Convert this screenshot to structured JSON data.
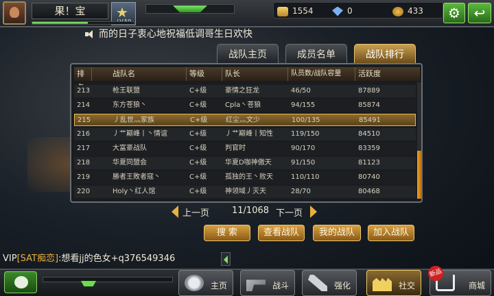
{
  "header": {
    "player_name": "果！宝",
    "rank_level": "LV.59",
    "xp_fraction": 0.55,
    "resources": {
      "gold": "1554",
      "diamond": "0",
      "coin": "433"
    },
    "icons": [
      "gear-icon",
      "back-arrow-icon",
      "gold-icon",
      "diamond-icon",
      "coin-icon"
    ]
  },
  "announcement": {
    "text": "而的日子衷心地祝福低调哥生日欢快"
  },
  "tabs": [
    {
      "label": "战队主页",
      "active": false
    },
    {
      "label": "成员名单",
      "active": false
    },
    {
      "label": "战队排行",
      "active": true
    }
  ],
  "table": {
    "headers": [
      "排名",
      "战队名",
      "等级",
      "队长",
      "队员数/战队容量",
      "活跃度"
    ],
    "rows": [
      {
        "rank": "213",
        "name": "枪王联盟",
        "level": "C+级",
        "leader": "豪情之狂龙",
        "count": "46/50",
        "active": "87889"
      },
      {
        "rank": "214",
        "name": "东方苍狼丶",
        "level": "C+级",
        "leader": "Cpla丶苍狼",
        "count": "94/155",
        "active": "85874"
      },
      {
        "rank": "215",
        "name": "丿乱世灬家族",
        "level": "C+级",
        "leader": "红尘灬文少",
        "count": "100/135",
        "active": "85491",
        "selected": true
      },
      {
        "rank": "216",
        "name": "丿艹巅峰丨丶情谊",
        "level": "C+级",
        "leader": "丿艹巅峰丨知性",
        "count": "119/150",
        "active": "84510"
      },
      {
        "rank": "217",
        "name": "大富豪战队",
        "level": "C+级",
        "leader": "判官时",
        "count": "90/170",
        "active": "83359"
      },
      {
        "rank": "218",
        "name": "华夏同盟会",
        "level": "C+级",
        "leader": "华夏D咖神傲天",
        "count": "91/150",
        "active": "81123"
      },
      {
        "rank": "219",
        "name": "勝者王敗者寇丶",
        "level": "C+级",
        "leader": "孤独的王丶败天",
        "count": "110/110",
        "active": "80740"
      },
      {
        "rank": "220",
        "name": "Holy丶红人馆",
        "level": "C+级",
        "leader": "神领域丿灭天",
        "count": "28/70",
        "active": "80468"
      }
    ]
  },
  "pager": {
    "prev": "上一页",
    "page": "11/1068",
    "next": "下一页"
  },
  "buttons": {
    "search": "搜 索",
    "view": "查看战队",
    "mine": "我的战队",
    "join": "加入战队"
  },
  "chat": {
    "prefix": "VIP",
    "user": "[SAT痴恋]",
    "message": ":想看jj的色女+q376549346"
  },
  "nav": {
    "home": "主页",
    "battle": "战斗",
    "upgrade": "强化",
    "social": "社交",
    "shop": "商城",
    "new_tag": "新品"
  },
  "colors": {
    "accent_gold": "#e8b040",
    "accent_green": "#5ab83c",
    "selected_row": "#8a6a30"
  }
}
